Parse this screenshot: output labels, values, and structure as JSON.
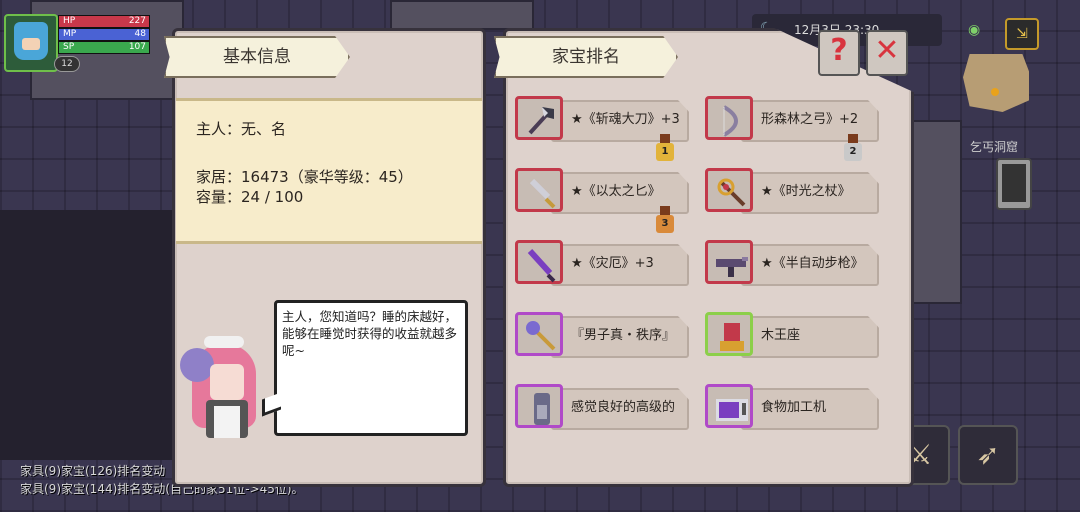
{
  "hud": {
    "hp_label": "HP",
    "hp_value": "227",
    "mp_label": "MP",
    "mp_value": "48",
    "sp_label": "SP",
    "sp_value": "107",
    "level": "12",
    "clock": "12月3日 23:30",
    "location": "乞丐洞窟"
  },
  "info_panel": {
    "title": "基本信息",
    "owner": "主人：无、名",
    "home": "家居：16473（豪华等级：45）",
    "capacity": "容量：24 / 100",
    "maid_speech": "主人，您知道吗？睡的床越好，能够在睡觉时获得的收益就越多呢~"
  },
  "ranking_panel": {
    "title": "家宝排名",
    "items": [
      {
        "name": "★《斩魂大刀》+3",
        "rank": "1",
        "rarity": "red",
        "icon": "axe-icon"
      },
      {
        "name": "形森林之弓》+2",
        "rank": "2",
        "rarity": "red",
        "icon": "bow-icon"
      },
      {
        "name": "★《以太之匕》",
        "rank": "3",
        "rarity": "red",
        "icon": "dagger-icon"
      },
      {
        "name": "★《时光之杖》",
        "rank": "",
        "rarity": "red",
        "icon": "staff-icon"
      },
      {
        "name": "★《灾厄》+3",
        "rank": "",
        "rarity": "red",
        "icon": "sword-icon"
      },
      {
        "name": "★《半自动步枪》",
        "rank": "",
        "rarity": "red",
        "icon": "rifle-icon"
      },
      {
        "name": "『男子真・秩序』",
        "rank": "",
        "rarity": "purple",
        "icon": "scepter-icon"
      },
      {
        "name": "木王座",
        "rank": "",
        "rarity": "green",
        "icon": "throne-icon"
      },
      {
        "name": "感觉良好的高级的",
        "rank": "",
        "rarity": "purple",
        "icon": "fridge-icon"
      },
      {
        "name": "食物加工机",
        "rank": "",
        "rarity": "purple",
        "icon": "microwave-icon"
      }
    ]
  },
  "log": {
    "line1": "家具(9)家宝(126)排名变动",
    "line2": "家具(9)家宝(144)排名变动(自己的家51位->45位)。"
  },
  "colors": {
    "rank1": "#e2b33a",
    "rank2": "#c9c9c9",
    "rank3": "#d98a3a"
  }
}
